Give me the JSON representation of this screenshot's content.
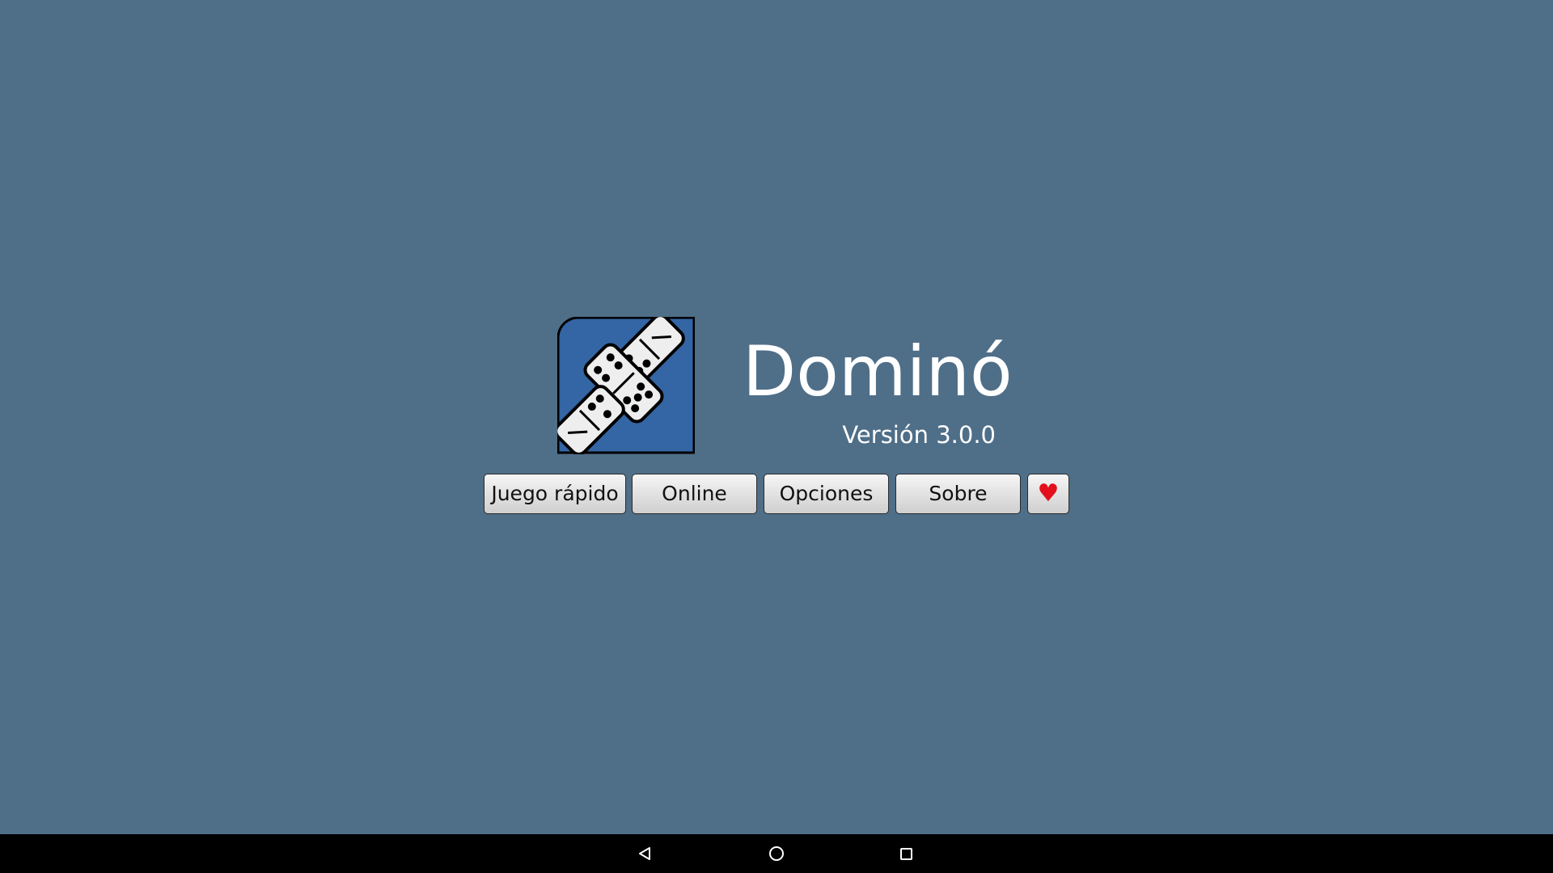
{
  "app": {
    "title": "Dominó",
    "version": "Versión 3.0.0"
  },
  "menu": {
    "quick_game": "Juego rápido",
    "online": "Online",
    "options": "Opciones",
    "about": "Sobre",
    "favorite_icon": "heart-icon"
  },
  "navbar": {
    "back_icon": "back-icon",
    "home_icon": "home-icon",
    "recent_icon": "recent-apps-icon"
  },
  "colors": {
    "background": "#4f6e88",
    "logo_background": "#3465a4",
    "heart": "#e3101c"
  }
}
